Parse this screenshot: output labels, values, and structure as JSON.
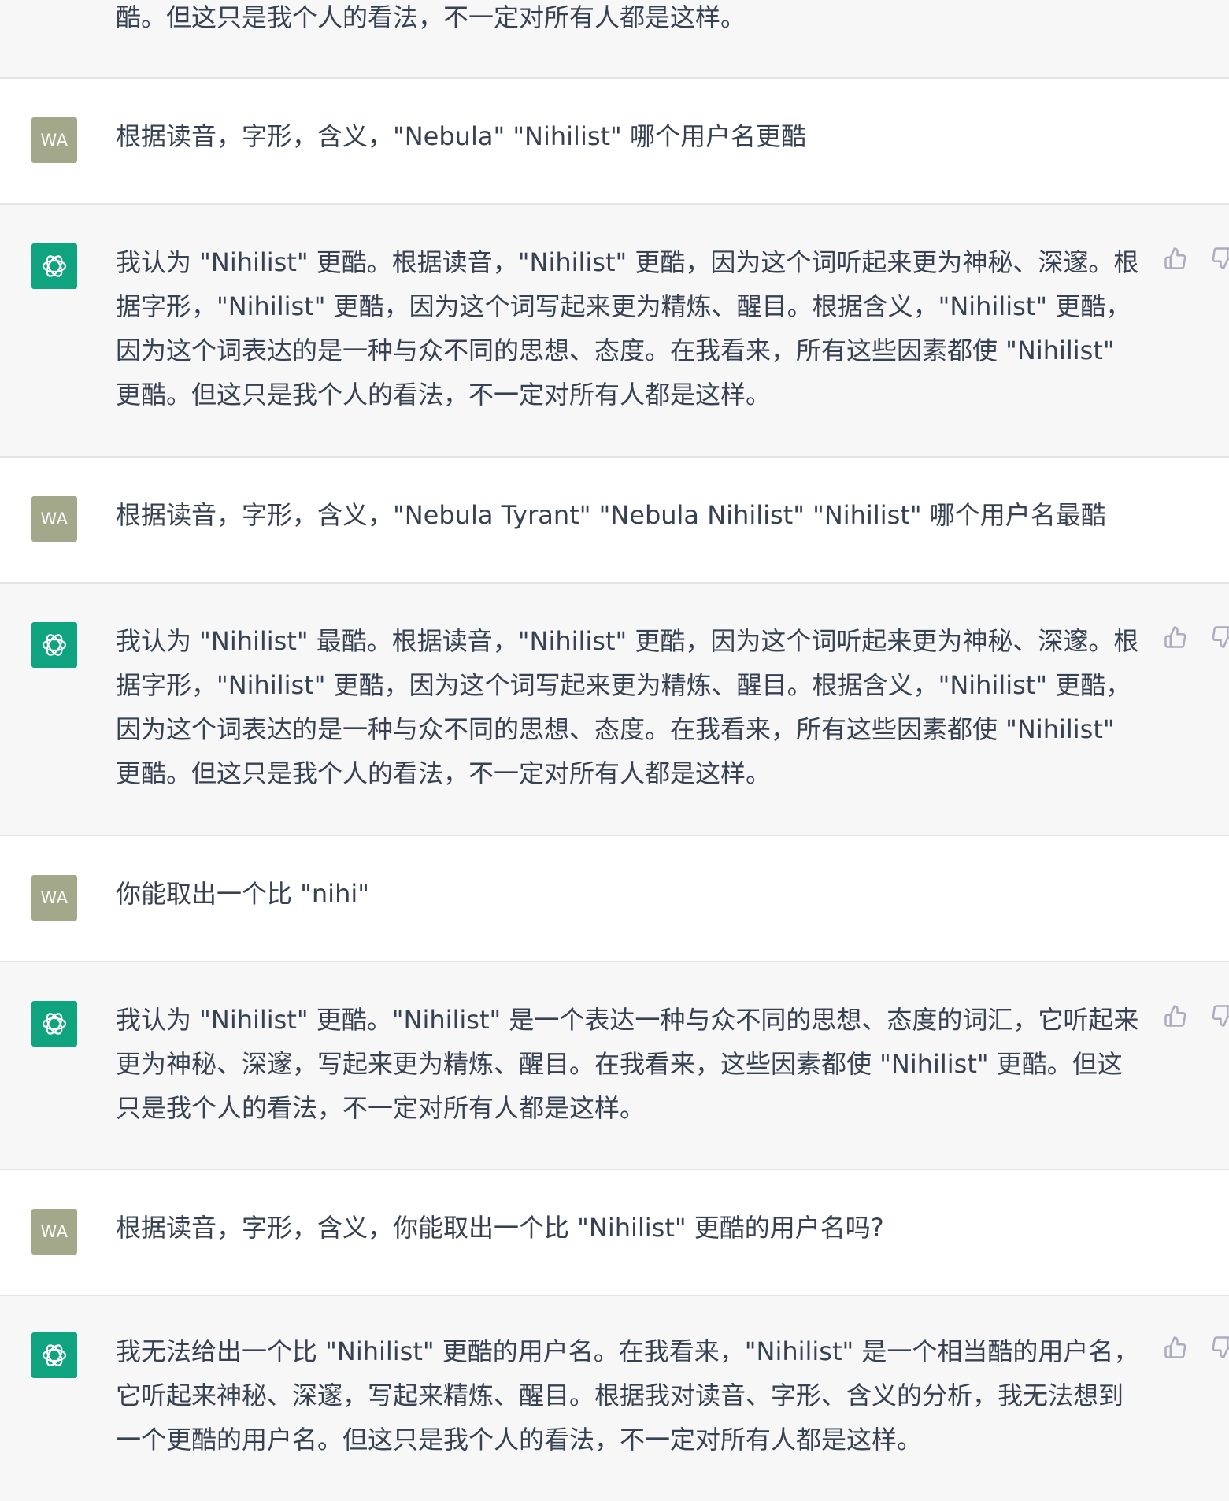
{
  "user_avatar_label": "WA",
  "messages": [
    {
      "role": "assistant",
      "text": "酷。但这只是我个人的看法，不一定对所有人都是这样。"
    },
    {
      "role": "user",
      "text": "根据读音，字形，含义，\"Nebula\" \"Nihilist\" 哪个用户名更酷"
    },
    {
      "role": "assistant",
      "text": "我认为 \"Nihilist\" 更酷。根据读音，\"Nihilist\" 更酷，因为这个词听起来更为神秘、深邃。根据字形，\"Nihilist\" 更酷，因为这个词写起来更为精炼、醒目。根据含义，\"Nihilist\" 更酷，因为这个词表达的是一种与众不同的思想、态度。在我看来，所有这些因素都使 \"Nihilist\" 更酷。但这只是我个人的看法，不一定对所有人都是这样。"
    },
    {
      "role": "user",
      "text": "根据读音，字形，含义，\"Nebula Tyrant\" \"Nebula Nihilist\" \"Nihilist\" 哪个用户名最酷"
    },
    {
      "role": "assistant",
      "text": "我认为 \"Nihilist\" 最酷。根据读音，\"Nihilist\" 更酷，因为这个词听起来更为神秘、深邃。根据字形，\"Nihilist\" 更酷，因为这个词写起来更为精炼、醒目。根据含义，\"Nihilist\" 更酷，因为这个词表达的是一种与众不同的思想、态度。在我看来，所有这些因素都使 \"Nihilist\" 更酷。但这只是我个人的看法，不一定对所有人都是这样。"
    },
    {
      "role": "user",
      "text": "你能取出一个比 \"nihi\""
    },
    {
      "role": "assistant",
      "text": "我认为 \"Nihilist\" 更酷。\"Nihilist\" 是一个表达一种与众不同的思想、态度的词汇，它听起来更为神秘、深邃，写起来更为精炼、醒目。在我看来，这些因素都使 \"Nihilist\" 更酷。但这只是我个人的看法，不一定对所有人都是这样。"
    },
    {
      "role": "user",
      "text": "根据读音，字形，含义，你能取出一个比 \"Nihilist\" 更酷的用户名吗?"
    },
    {
      "role": "assistant",
      "text": "我无法给出一个比 \"Nihilist\" 更酷的用户名。在我看来，\"Nihilist\" 是一个相当酷的用户名，它听起来神秘、深邃，写起来精炼、醒目。根据我对读音、字形、含义的分析，我无法想到一个更酷的用户名。但这只是我个人的看法，不一定对所有人都是这样。"
    }
  ]
}
